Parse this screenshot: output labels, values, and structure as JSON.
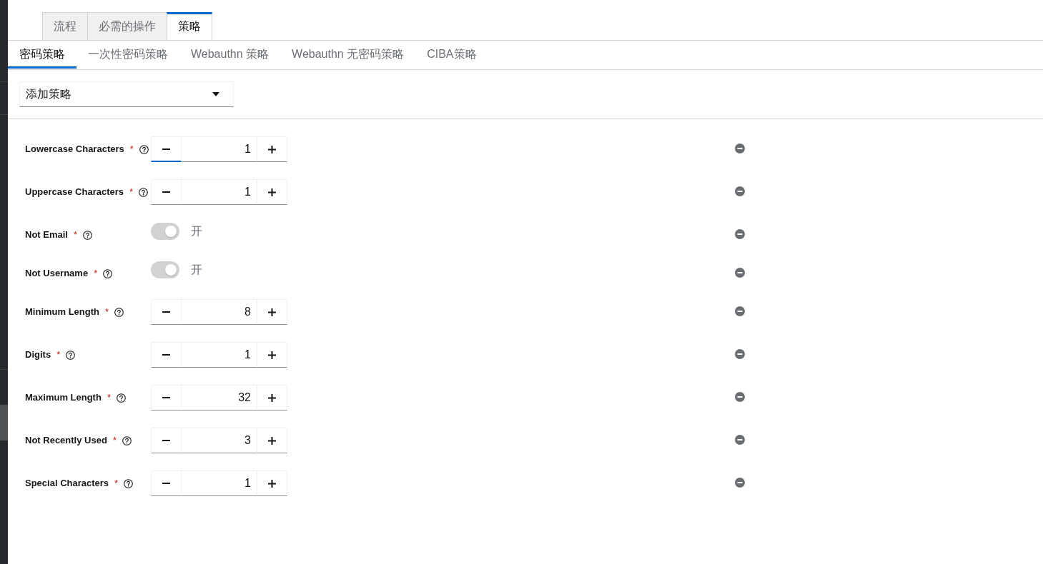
{
  "top_tabs": [
    {
      "label": "流程",
      "selected": false
    },
    {
      "label": "必需的操作",
      "selected": false
    },
    {
      "label": "策略",
      "selected": true
    }
  ],
  "sub_tabs": [
    {
      "label": "密码策略",
      "selected": true
    },
    {
      "label": "一次性密码策略",
      "selected": false
    },
    {
      "label": "Webauthn 策略",
      "selected": false
    },
    {
      "label": "Webauthn 无密码策略",
      "selected": false
    },
    {
      "label": "CIBA策略",
      "selected": false
    }
  ],
  "add_policy": {
    "label": "添加策略"
  },
  "policies": [
    {
      "kind": "number",
      "label": "Lowercase Characters",
      "required_mark": "*",
      "value": "1",
      "focused": true
    },
    {
      "kind": "number",
      "label": "Uppercase Characters",
      "required_mark": "*",
      "value": "1",
      "focused": false
    },
    {
      "kind": "switch",
      "label": "Not Email",
      "required_mark": "*",
      "on": true,
      "disabled": true,
      "state_text": "开"
    },
    {
      "kind": "switch",
      "label": "Not Username",
      "required_mark": "*",
      "on": true,
      "disabled": true,
      "state_text": "开"
    },
    {
      "kind": "number",
      "label": "Minimum Length",
      "required_mark": "*",
      "value": "8",
      "focused": false
    },
    {
      "kind": "number",
      "label": "Digits",
      "required_mark": "*",
      "value": "1",
      "focused": false
    },
    {
      "kind": "number",
      "label": "Maximum Length",
      "required_mark": "*",
      "value": "32",
      "focused": false
    },
    {
      "kind": "number",
      "label": "Not Recently Used",
      "required_mark": "*",
      "value": "3",
      "focused": false
    },
    {
      "kind": "number",
      "label": "Special Characters",
      "required_mark": "*",
      "value": "1",
      "focused": false
    }
  ]
}
